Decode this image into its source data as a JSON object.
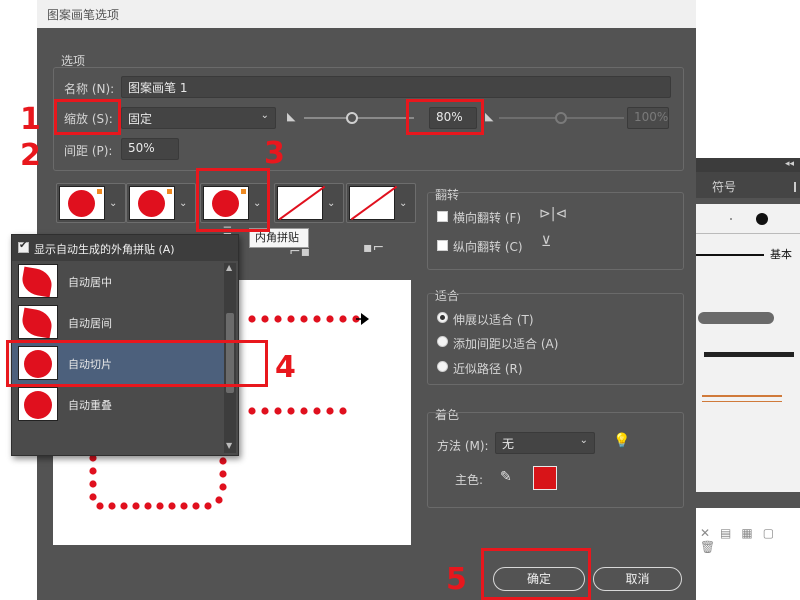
{
  "dialog": {
    "title": "图案画笔选项",
    "options_label": "选项",
    "name_label": "名称 (N):",
    "name_value": "图案画笔 1",
    "scale_label": "缩放 (S):",
    "scale_select": "固定",
    "scale_value": "80%",
    "scale_max": "100%",
    "spacing_label": "间距 (P):",
    "spacing_value": "50%",
    "flip": {
      "label": "翻转",
      "horizontal": "横向翻转 (F)",
      "vertical": "纵向翻转 (C)"
    },
    "fit": {
      "label": "适合",
      "options": [
        "伸展以适合 (T)",
        "添加间距以适合 (A)",
        "近似路径 (R)"
      ],
      "selected": "伸展以适合 (T)"
    },
    "colorize": {
      "label": "着色",
      "method_label": "方法 (M):",
      "method_value": "无",
      "key_color_label": "主色:",
      "key_color": "#d81418"
    },
    "ok_label": "确定",
    "cancel_label": "取消"
  },
  "tooltip": "内角拼贴",
  "menu": {
    "header_label": "显示自动生成的外角拼贴 (A)",
    "items": [
      "自动居中",
      "自动居间",
      "自动切片",
      "自动重叠"
    ],
    "selected": "自动切片"
  },
  "brushes_panel": {
    "tab_label": "符号",
    "basic_label": "基本"
  },
  "annotations": [
    "1",
    "2",
    "3",
    "4",
    "5"
  ],
  "colors": {
    "accent_red": "#e8171d",
    "dialog_bg": "#535353",
    "selected_item": "#4c607c"
  }
}
